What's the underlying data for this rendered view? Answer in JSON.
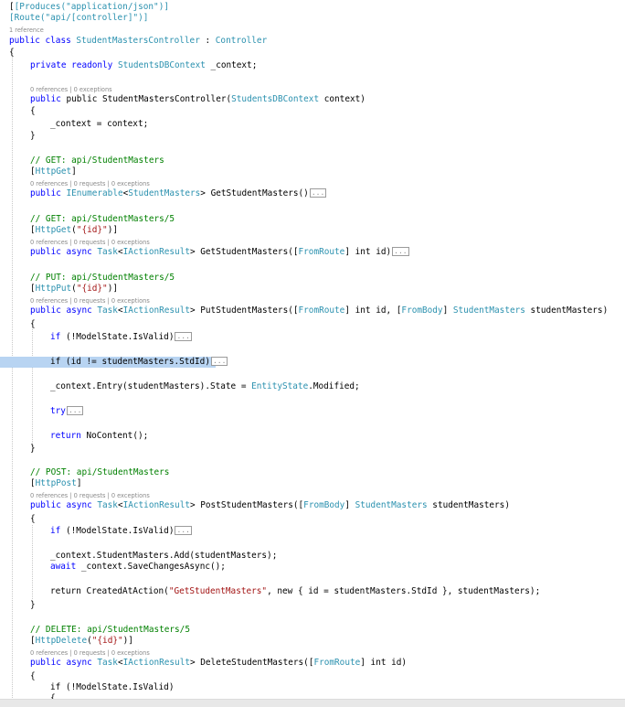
{
  "code": {
    "l1": "[Produces(\"application/json\")]",
    "l2": "[Route(\"api/[controller]\")]",
    "lens_ref": "1 reference",
    "l4a": "public class ",
    "l4b": "StudentMastersController",
    "l4c": " : ",
    "l4d": "Controller",
    "brace_open": "{",
    "brace_close": "}",
    "field_a": "private readonly ",
    "field_b": "StudentsDBContext",
    "field_c": " _context;",
    "lens_ctor": "0 references | 0 exceptions",
    "ctor_a": "public StudentMastersController(",
    "ctor_b": "StudentsDBContext",
    "ctor_c": " context)",
    "ctor_body": "_context = context;",
    "c_get": "// GET: api/StudentMasters",
    "attr_httpget": "HttpGet",
    "lens_req": "0 references | 0 requests | 0 exceptions",
    "get1_a": "public ",
    "get1_b": "IEnumerable",
    "get1_c": "<",
    "get1_d": "StudentMasters",
    "get1_e": "> GetStudentMasters()",
    "collapsed": "...",
    "c_get_id": "// GET: api/StudentMasters/5",
    "attr_httpget_id_a": "HttpGet",
    "str_id": "\"{id}\"",
    "get2_a": "public async ",
    "get2_b": "Task",
    "get2_c": "IActionResult",
    "get2_d": "> GetStudentMasters([",
    "fromroute": "FromRoute",
    "get2_e": "] int id)",
    "c_put": "// PUT: api/StudentMasters/5",
    "attr_httpput": "HttpPut",
    "put_d": "> PutStudentMasters([",
    "put_e": "] int id, [",
    "frombody": "FromBody",
    "put_f": "] ",
    "put_g": "StudentMasters",
    "put_h": " studentMasters)",
    "if_valid": "if (!ModelState.IsValid)",
    "if_id": "if (id != studentMasters.StdId)",
    "entry_a": "_context.Entry(studentMasters).State = ",
    "entry_b": "EntityState",
    "entry_c": ".Modified;",
    "try": "try",
    "ret_nocontent": "return NoContent();",
    "c_post": "// POST: api/StudentMasters",
    "attr_httppost": "HttpPost",
    "post_d": "> PostStudentMasters([",
    "post_e": "] ",
    "post_f": " studentMasters)",
    "add": "_context.StudentMasters.Add(studentMasters);",
    "save": "await _context.SaveChangesAsync();",
    "ret_created_a": "return CreatedAtAction(",
    "ret_created_b": "\"GetStudentMasters\"",
    "ret_created_c": ", new { id = studentMasters.StdId }, studentMasters);",
    "c_delete": "// DELETE: api/StudentMasters/5",
    "attr_httpdelete": "HttpDelete",
    "del_d": "> DeleteStudentMasters([",
    "del_e": "] int id)",
    "if_valid_last": "if (!ModelState.IsValid)",
    "partial": "{"
  },
  "colors": {
    "keyword": "#0000ff",
    "type": "#2b91af",
    "string": "#a31515",
    "comment": "#008000",
    "selection": "#b8d4f2"
  }
}
